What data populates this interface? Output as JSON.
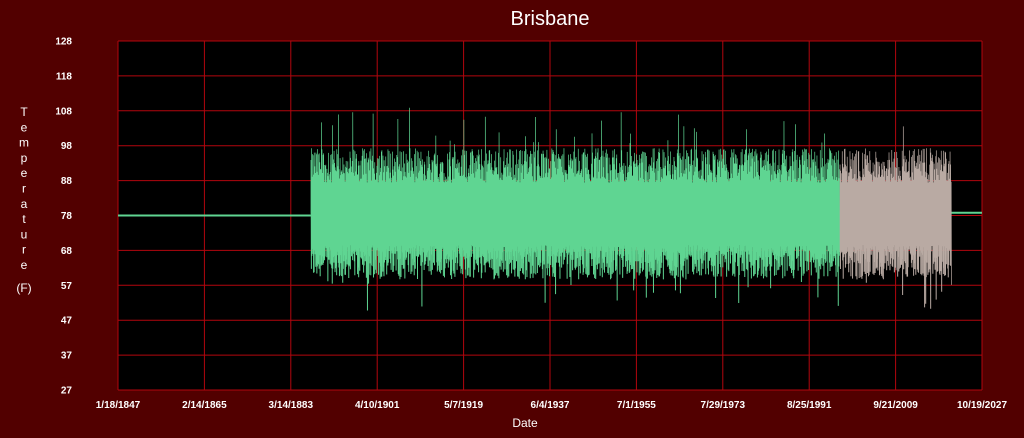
{
  "chart_data": {
    "type": "line",
    "title": "Brisbane",
    "xlabel": "Date",
    "ylabel_letters": [
      "T",
      "e",
      "m",
      "p",
      "e",
      "r",
      "a",
      "t",
      "u",
      "r",
      "e"
    ],
    "ylabel_unit": "(F)",
    "y_ticks": [
      "128",
      "118",
      "108",
      "98",
      "88",
      "78",
      "68",
      "57",
      "47",
      "37",
      "27"
    ],
    "ylim": [
      27,
      128
    ],
    "x_ticks": [
      "1/18/1847",
      "2/14/1865",
      "3/14/1883",
      "4/10/1901",
      "5/7/1919",
      "6/4/1937",
      "7/1/1955",
      "7/29/1973",
      "8/25/1991",
      "9/21/2009",
      "10/19/2027"
    ],
    "xlim": [
      "1847-01-18",
      "2027-10-19"
    ],
    "grid": true,
    "series": [
      {
        "color": "#5fd592",
        "description": "daily temperature",
        "baseline_before": {
          "start": "1847-01-18",
          "end": "1887-06-01",
          "value": 77.5
        },
        "oscillation": {
          "start": "1887-06-01",
          "end": "2021-06-01",
          "mean": 78,
          "typical_high": 92,
          "typical_low": 64,
          "max": 110,
          "min": 50
        },
        "baseline_after": {
          "start": "2021-06-01",
          "end": "2027-10-19",
          "value": 78.3
        }
      }
    ],
    "color_shift": {
      "start": "1998-01-01",
      "end": "2021-06-01",
      "color": "#b9aaa3"
    },
    "colors": {
      "background": "#520000",
      "plot_area": "#000000",
      "grid": "#b3060e",
      "line": "#5fd592",
      "recent_line": "#b9aaa3"
    }
  }
}
